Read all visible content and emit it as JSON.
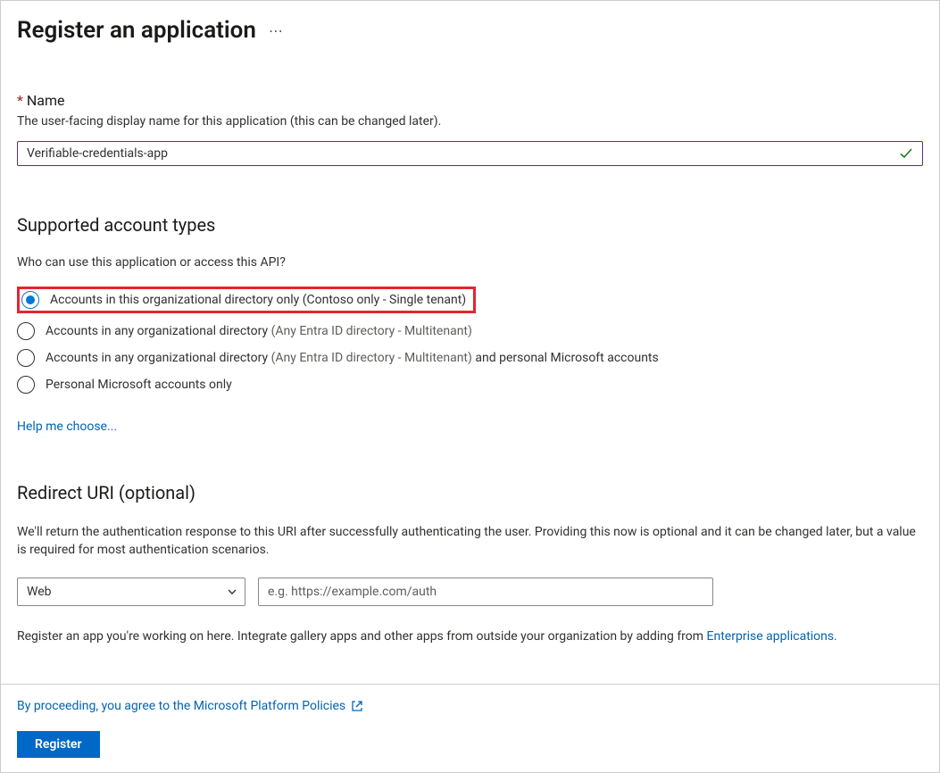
{
  "header": {
    "title": "Register an application"
  },
  "name_section": {
    "required_marker": "*",
    "label": "Name",
    "description": "The user-facing display name for this application (this can be changed later).",
    "value": "Verifiable-credentials-app"
  },
  "account_types": {
    "heading": "Supported account types",
    "sublabel": "Who can use this application or access this API?",
    "options": [
      {
        "label": "Accounts in this organizational directory only (Contoso only - Single tenant)",
        "muted_suffix": "",
        "trailing": "",
        "selected": true,
        "highlighted": true
      },
      {
        "label": "Accounts in any organizational directory ",
        "muted_suffix": "(Any Entra ID directory - Multitenant)",
        "trailing": "",
        "selected": false,
        "highlighted": false
      },
      {
        "label": "Accounts in any organizational directory ",
        "muted_suffix": "(Any Entra ID directory - Multitenant) ",
        "trailing": " and personal Microsoft accounts",
        "selected": false,
        "highlighted": false
      },
      {
        "label": "Personal Microsoft accounts only",
        "muted_suffix": "",
        "trailing": "",
        "selected": false,
        "highlighted": false
      }
    ],
    "help_link": "Help me choose..."
  },
  "redirect": {
    "heading": "Redirect URI (optional)",
    "description": "We'll return the authentication response to this URI after successfully authenticating the user. Providing this now is optional and it can be changed later, but a value is required for most authentication scenarios.",
    "platform_value": "Web",
    "uri_placeholder": "e.g. https://example.com/auth"
  },
  "footer": {
    "register_note_pre": "Register an app you're working on here. Integrate gallery apps and other apps from outside your organization by adding from ",
    "enterprise_link": "Enterprise applications.",
    "policies_text": "By proceeding, you agree to the Microsoft Platform Policies",
    "register_button": "Register"
  }
}
